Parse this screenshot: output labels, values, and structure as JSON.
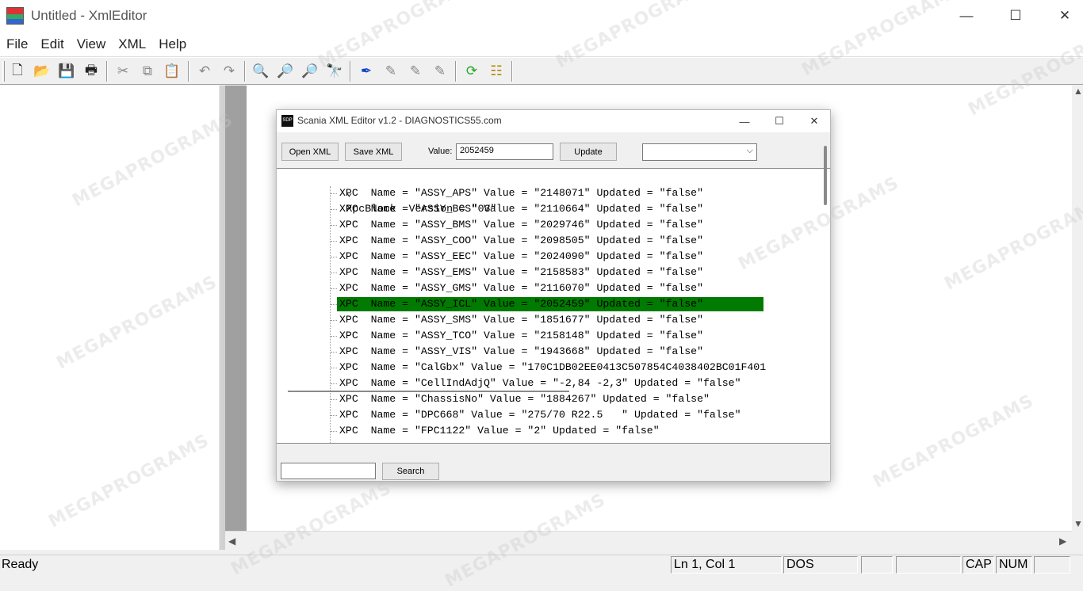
{
  "window": {
    "title": "Untitled - XmlEditor"
  },
  "menu": [
    "File",
    "Edit",
    "View",
    "XML",
    "Help"
  ],
  "toolbar": {
    "buttons": [
      {
        "name": "new-file-icon",
        "glyph": "🗋"
      },
      {
        "name": "open-folder-icon",
        "glyph": "📂"
      },
      {
        "name": "save-icon",
        "glyph": "💾"
      },
      {
        "name": "print-icon",
        "glyph": "🖶"
      },
      {
        "name": "cut-icon",
        "glyph": "✂"
      },
      {
        "name": "copy-icon",
        "glyph": "⧉"
      },
      {
        "name": "paste-icon",
        "glyph": "📋"
      },
      {
        "name": "undo-icon",
        "glyph": "↶"
      },
      {
        "name": "redo-icon",
        "glyph": "↷"
      },
      {
        "name": "find-icon",
        "glyph": "🔍"
      },
      {
        "name": "find-next-icon",
        "glyph": "🔎"
      },
      {
        "name": "find-prev-icon",
        "glyph": "🔎"
      },
      {
        "name": "replace-icon",
        "glyph": "🔭"
      },
      {
        "name": "bookmark-icon",
        "glyph": "✒"
      },
      {
        "name": "bookmark-next-icon",
        "glyph": "✎"
      },
      {
        "name": "bookmark-prev-icon",
        "glyph": "✎"
      },
      {
        "name": "bookmark-clear-icon",
        "glyph": "✎"
      },
      {
        "name": "validate-icon",
        "glyph": "⟳"
      },
      {
        "name": "tree-view-icon",
        "glyph": "☷"
      }
    ]
  },
  "status": {
    "text": "Ready",
    "position": "Ln 1, Col 1",
    "format": "DOS",
    "cap": "CAP",
    "num": "NUM"
  },
  "dialog": {
    "title": "Scania XML Editor v1.2 - DIAGNOSTICS55.com",
    "open_label": "Open XML",
    "save_label": "Save XML",
    "value_label": "Value:",
    "value": "2052459",
    "update_label": "Update",
    "dropdown_value": "",
    "search_value": "",
    "search_label": "Search",
    "tree": {
      "root": "XpcBlock  Version = \"03\"",
      "items": [
        "XPC  Name = \"ASSY_APS\" Value = \"2148071\" Updated = \"false\"",
        "XPC  Name = \"ASSY_BCS\" Value = \"2110664\" Updated = \"false\"",
        "XPC  Name = \"ASSY_BMS\" Value = \"2029746\" Updated = \"false\"",
        "XPC  Name = \"ASSY_COO\" Value = \"2098505\" Updated = \"false\"",
        "XPC  Name = \"ASSY_EEC\" Value = \"2024090\" Updated = \"false\"",
        "XPC  Name = \"ASSY_EMS\" Value = \"2158583\" Updated = \"false\"",
        "XPC  Name = \"ASSY_GMS\" Value = \"2116070\" Updated = \"false\"",
        "XPC  Name = \"ASSY_ICL\" Value = \"2052459\" Updated = \"false\"",
        "XPC  Name = \"ASSY_SMS\" Value = \"1851677\" Updated = \"false\"",
        "XPC  Name = \"ASSY_TCO\" Value = \"2158148\" Updated = \"false\"",
        "XPC  Name = \"ASSY_VIS\" Value = \"1943668\" Updated = \"false\"",
        "XPC  Name = \"CalGbx\" Value = \"170C1DB02EE0413C507854C4038402BC01F401",
        "XPC  Name = \"CellIndAdjQ\" Value = \"-2,84 -2,3\" Updated = \"false\"",
        "XPC  Name = \"ChassisNo\" Value = \"1884267\" Updated = \"false\"",
        "XPC  Name = \"DPC668\" Value = \"275/70 R22.5   \" Updated = \"false\"",
        "XPC  Name = \"FPC1122\" Value = \"2\" Updated = \"false\""
      ],
      "selected_index": 7
    }
  },
  "watermark": "MEGAPROGRAMS",
  "colors": {
    "selection": "#007a00"
  }
}
